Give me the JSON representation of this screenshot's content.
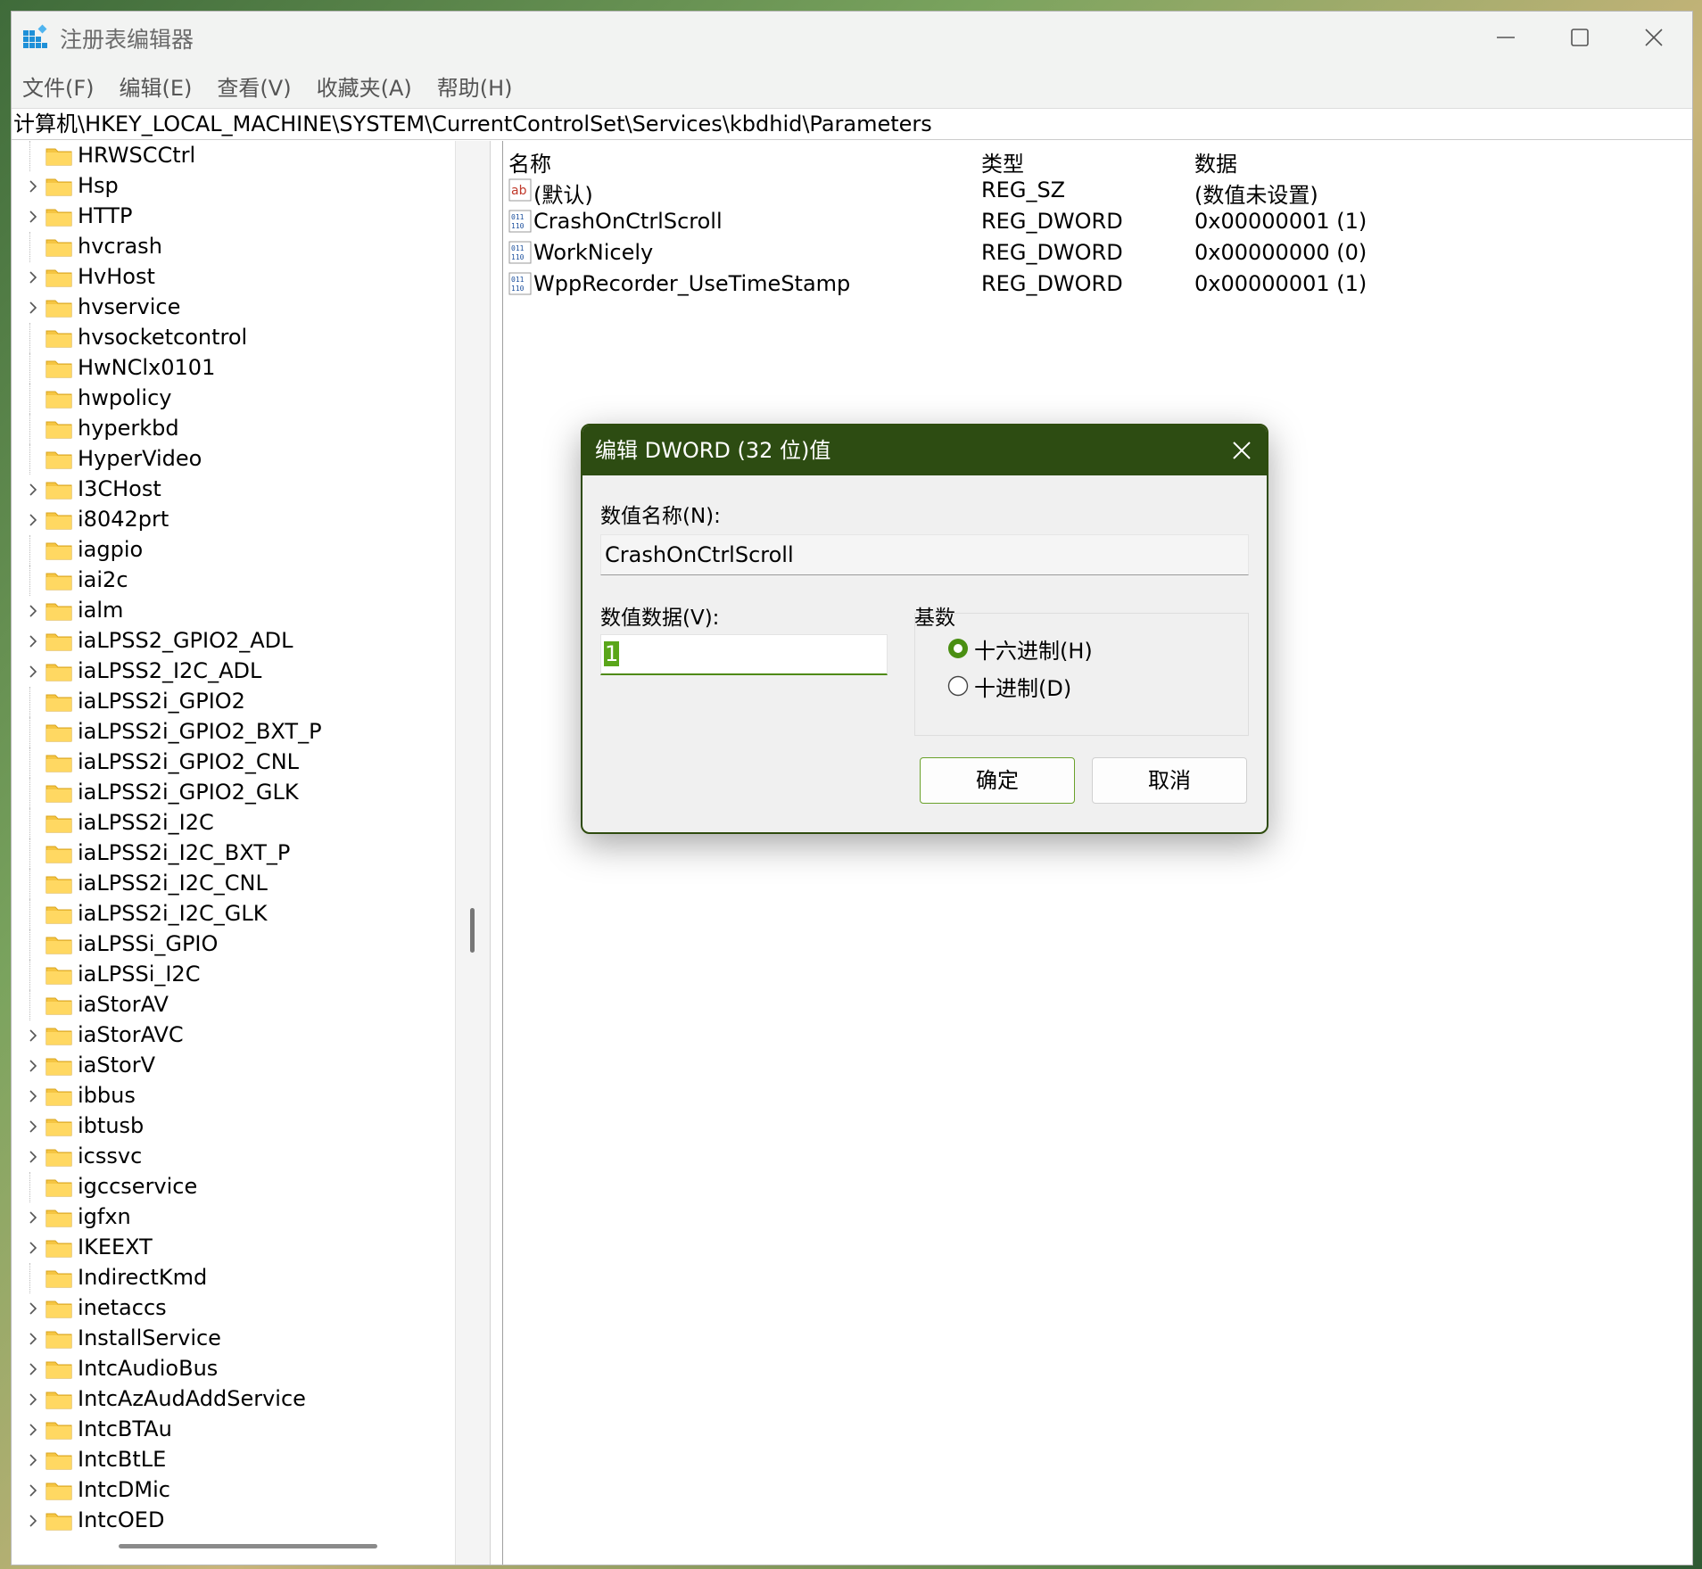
{
  "window": {
    "title": "注册表编辑器",
    "address": "计算机\\HKEY_LOCAL_MACHINE\\SYSTEM\\CurrentControlSet\\Services\\kbdhid\\Parameters"
  },
  "menu": [
    "文件(F)",
    "编辑(E)",
    "查看(V)",
    "收藏夹(A)",
    "帮助(H)"
  ],
  "tree": [
    {
      "label": "HRWSCCtrl",
      "expandable": false
    },
    {
      "label": "Hsp",
      "expandable": true
    },
    {
      "label": "HTTP",
      "expandable": true
    },
    {
      "label": "hvcrash",
      "expandable": false
    },
    {
      "label": "HvHost",
      "expandable": true
    },
    {
      "label": "hvservice",
      "expandable": true
    },
    {
      "label": "hvsocketcontrol",
      "expandable": false
    },
    {
      "label": "HwNClx0101",
      "expandable": false
    },
    {
      "label": "hwpolicy",
      "expandable": false
    },
    {
      "label": "hyperkbd",
      "expandable": false
    },
    {
      "label": "HyperVideo",
      "expandable": false
    },
    {
      "label": "I3CHost",
      "expandable": true
    },
    {
      "label": "i8042prt",
      "expandable": true
    },
    {
      "label": "iagpio",
      "expandable": false
    },
    {
      "label": "iai2c",
      "expandable": false
    },
    {
      "label": "ialm",
      "expandable": true
    },
    {
      "label": "iaLPSS2_GPIO2_ADL",
      "expandable": true
    },
    {
      "label": "iaLPSS2_I2C_ADL",
      "expandable": true
    },
    {
      "label": "iaLPSS2i_GPIO2",
      "expandable": false
    },
    {
      "label": "iaLPSS2i_GPIO2_BXT_P",
      "expandable": false
    },
    {
      "label": "iaLPSS2i_GPIO2_CNL",
      "expandable": false
    },
    {
      "label": "iaLPSS2i_GPIO2_GLK",
      "expandable": false
    },
    {
      "label": "iaLPSS2i_I2C",
      "expandable": false
    },
    {
      "label": "iaLPSS2i_I2C_BXT_P",
      "expandable": false
    },
    {
      "label": "iaLPSS2i_I2C_CNL",
      "expandable": false
    },
    {
      "label": "iaLPSS2i_I2C_GLK",
      "expandable": false
    },
    {
      "label": "iaLPSSi_GPIO",
      "expandable": false
    },
    {
      "label": "iaLPSSi_I2C",
      "expandable": false
    },
    {
      "label": "iaStorAV",
      "expandable": false
    },
    {
      "label": "iaStorAVC",
      "expandable": true
    },
    {
      "label": "iaStorV",
      "expandable": true
    },
    {
      "label": "ibbus",
      "expandable": true
    },
    {
      "label": "ibtusb",
      "expandable": true
    },
    {
      "label": "icssvc",
      "expandable": true
    },
    {
      "label": "igccservice",
      "expandable": false
    },
    {
      "label": "igfxn",
      "expandable": true
    },
    {
      "label": "IKEEXT",
      "expandable": true
    },
    {
      "label": "IndirectKmd",
      "expandable": false
    },
    {
      "label": "inetaccs",
      "expandable": true
    },
    {
      "label": "InstallService",
      "expandable": true
    },
    {
      "label": "IntcAudioBus",
      "expandable": true
    },
    {
      "label": "IntcAzAudAddService",
      "expandable": true
    },
    {
      "label": "IntcBTAu",
      "expandable": true
    },
    {
      "label": "IntcBtLE",
      "expandable": true
    },
    {
      "label": "IntcDMic",
      "expandable": true
    },
    {
      "label": "IntcOED",
      "expandable": true
    }
  ],
  "list": {
    "headers": {
      "name": "名称",
      "type": "类型",
      "data": "数据"
    },
    "rows": [
      {
        "icon": "string-value-icon",
        "name": "(默认)",
        "type": "REG_SZ",
        "data": "(数值未设置)"
      },
      {
        "icon": "binary-value-icon",
        "name": "CrashOnCtrlScroll",
        "type": "REG_DWORD",
        "data": "0x00000001 (1)"
      },
      {
        "icon": "binary-value-icon",
        "name": "WorkNicely",
        "type": "REG_DWORD",
        "data": "0x00000000 (0)"
      },
      {
        "icon": "binary-value-icon",
        "name": "WppRecorder_UseTimeStamp",
        "type": "REG_DWORD",
        "data": "0x00000001 (1)"
      }
    ]
  },
  "dialog": {
    "title": "编辑 DWORD (32 位)值",
    "name_label": "数值名称(N):",
    "name_value": "CrashOnCtrlScroll",
    "data_label": "数值数据(V):",
    "data_value": "1",
    "base_label": "基数",
    "hex_label": "十六进制(H)",
    "dec_label": "十进制(D)",
    "hex_selected": true,
    "ok_label": "确定",
    "cancel_label": "取消"
  },
  "colors": {
    "accent": "#2d4c12",
    "selection": "#5aa61a",
    "folder": "#f5c542"
  }
}
